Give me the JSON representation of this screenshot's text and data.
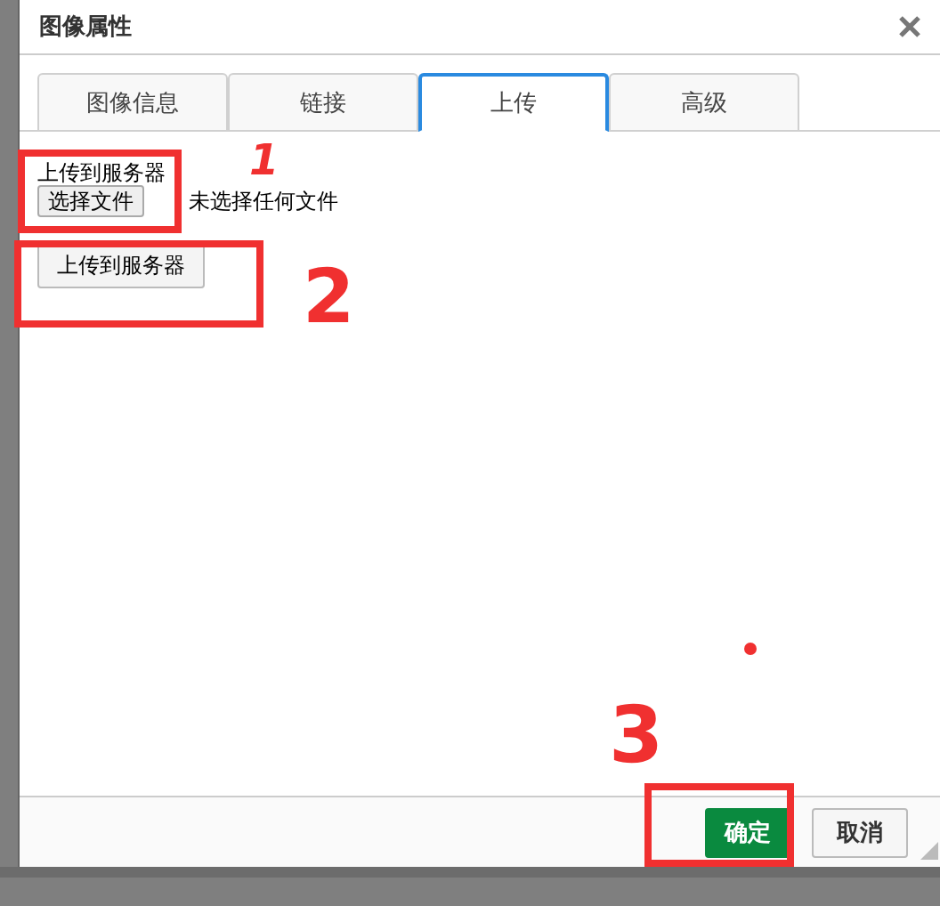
{
  "dialog": {
    "title": "图像属性",
    "tabs": [
      {
        "label": "图像信息",
        "selected": false
      },
      {
        "label": "链接",
        "selected": false
      },
      {
        "label": "上传",
        "selected": true
      },
      {
        "label": "高级",
        "selected": false
      }
    ],
    "upload": {
      "label": "上传到服务器",
      "file_button": "选择文件",
      "file_status": "未选择任何文件",
      "upload_button": "上传到服务器"
    },
    "buttons": [
      {
        "label": "确定",
        "kind": "primary"
      },
      {
        "label": "取消",
        "kind": "secondary"
      }
    ]
  },
  "annotations": [
    {
      "label": "1"
    },
    {
      "label": "2"
    },
    {
      "label": "3"
    }
  ]
}
